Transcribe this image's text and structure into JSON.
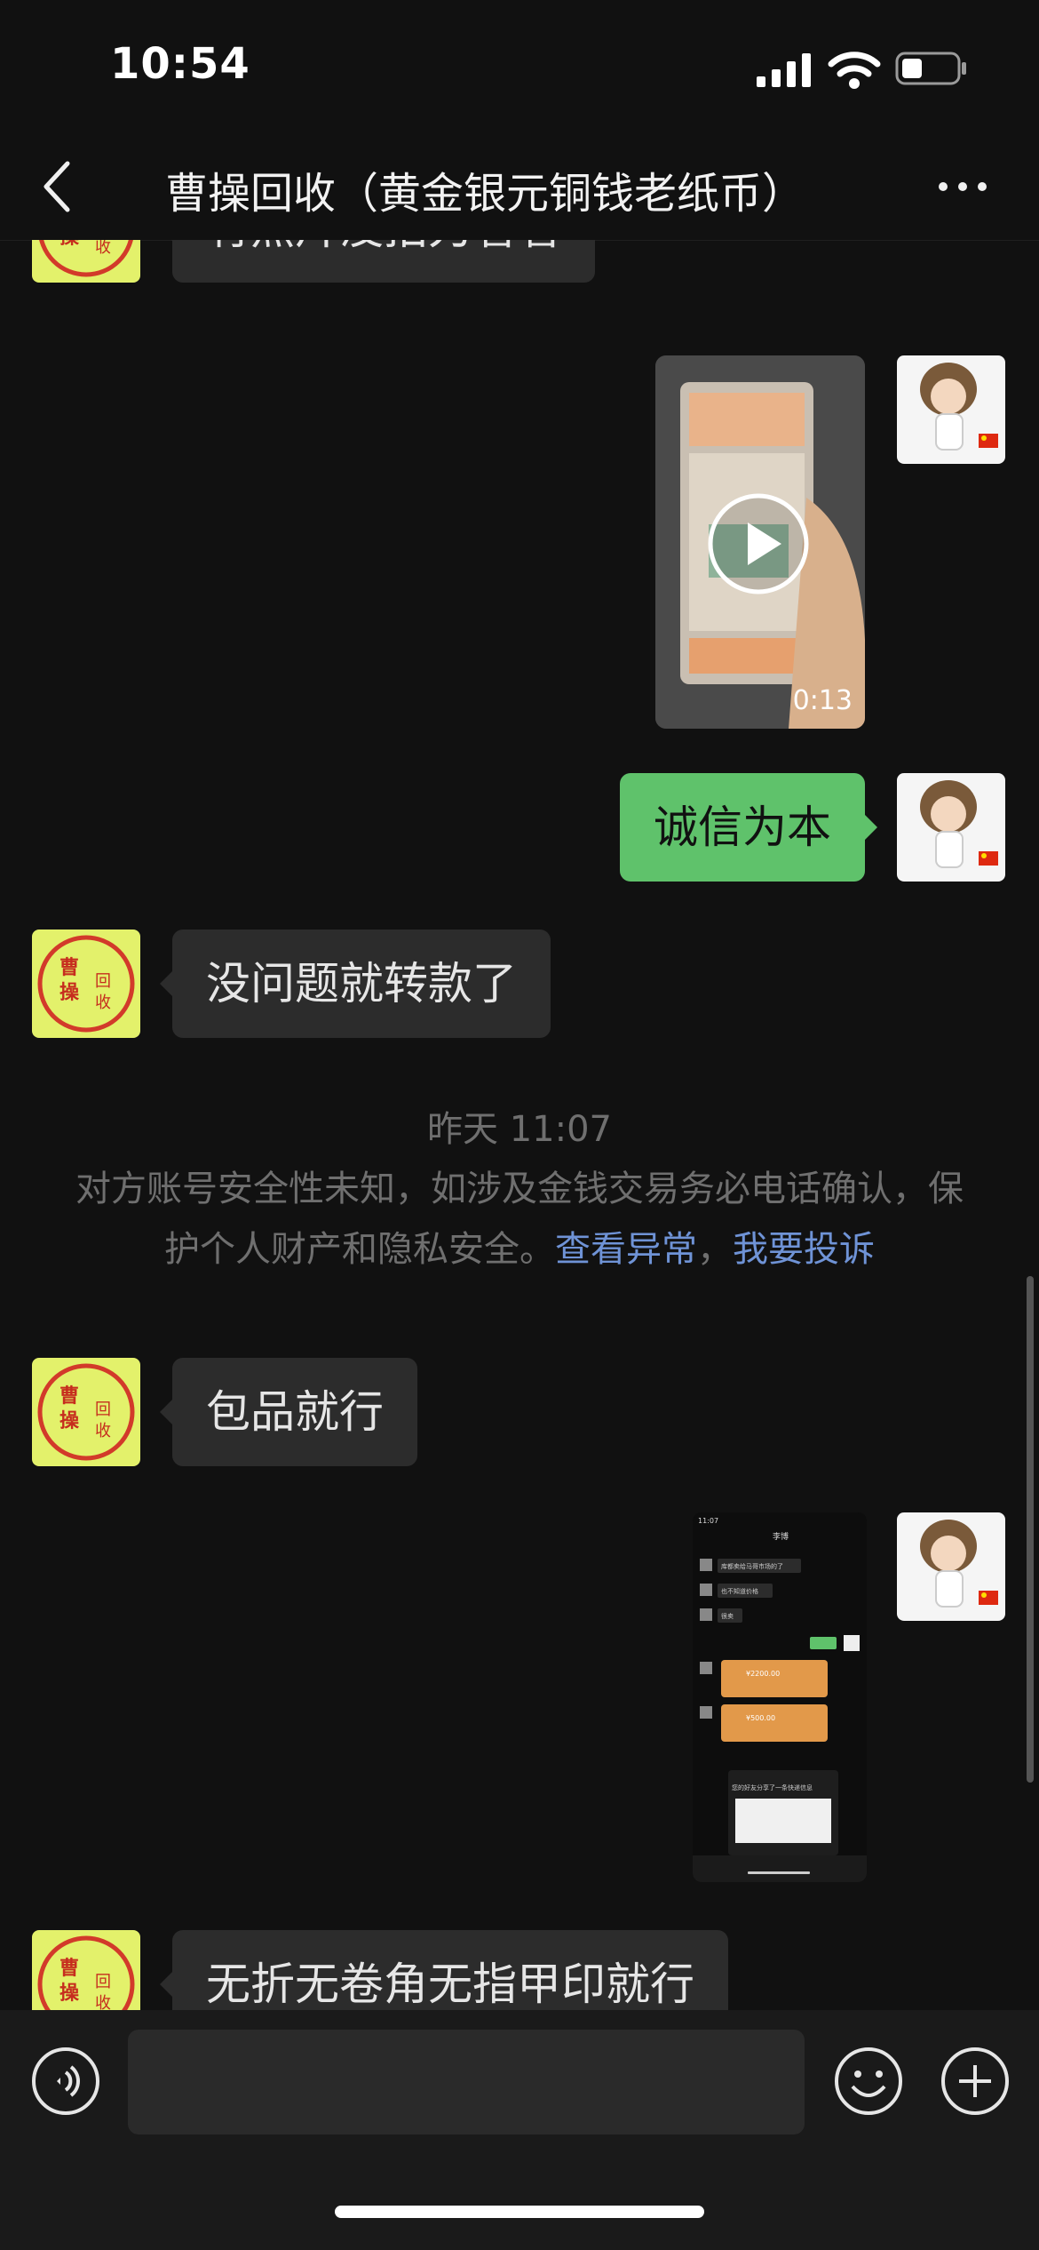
{
  "status": {
    "time": "10:54"
  },
  "nav": {
    "title": "曹操回收（黄金银元铜钱老纸币）"
  },
  "avatar_left": {
    "chars": [
      "曹",
      "操",
      "回",
      "收"
    ]
  },
  "messages": {
    "m1": "有照片没拍刀看看",
    "video_duration": "0:13",
    "m2": "诚信为本",
    "m3": "没问题就转款了",
    "m4": "包品就行",
    "m5": "无折无卷角无指甲印就行"
  },
  "timestamp": "昨天 11:07",
  "notice": {
    "text": "对方账号安全性未知，如涉及金钱交易务必电话确认，保护个人财产和隐私安全。",
    "link1": "查看异常",
    "sep": "，",
    "link2": "我要投诉"
  },
  "screenshot": {
    "time": "11:07",
    "contact": "李博",
    "rows": [
      "库都卖给马哥市场的了",
      "也不知道价格",
      "很卖"
    ],
    "t1": "¥2200.00",
    "t2": "¥500.00",
    "share": "您的好友分享了一条快递信息"
  },
  "colors": {
    "background": "#111111",
    "bubble_left": "#2c2c2c",
    "bubble_right": "#5fc26b",
    "link": "#6f93d6",
    "avatar_left_bg": "#e3f16b",
    "avatar_left_ring": "#d23a2a"
  },
  "icons": [
    "back-icon",
    "more-icon",
    "voice-icon",
    "emoji-icon",
    "plus-icon",
    "play-icon",
    "signal-icon",
    "wifi-icon",
    "battery-icon"
  ]
}
